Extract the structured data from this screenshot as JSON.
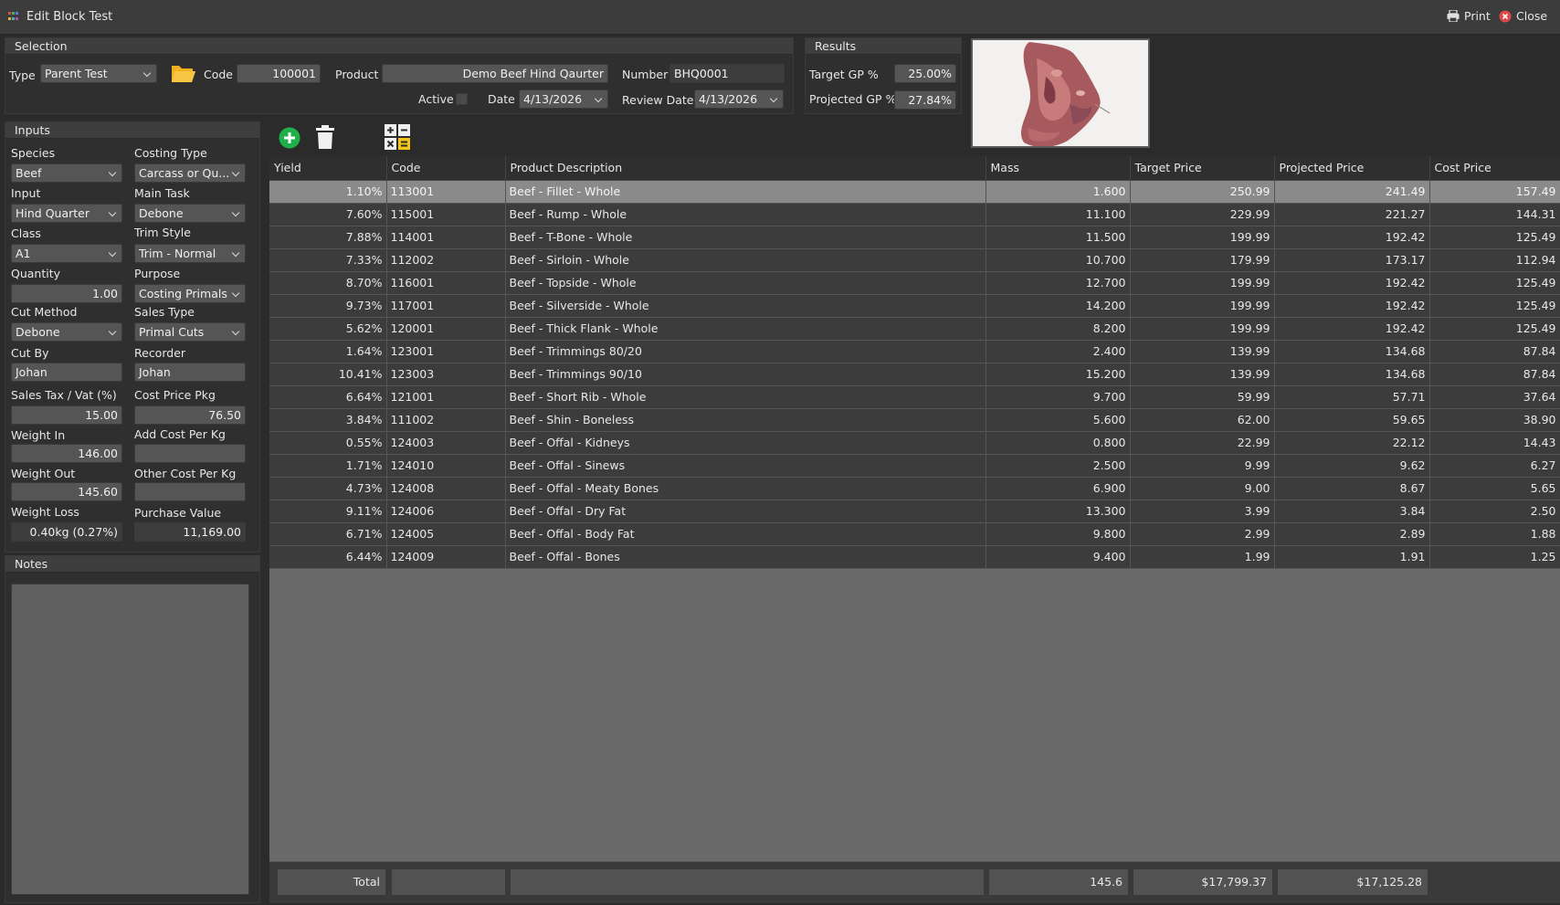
{
  "window": {
    "title": "Edit Block Test",
    "print_label": "Print",
    "close_label": "Close"
  },
  "selection": {
    "header": "Selection",
    "type_label": "Type",
    "type_value": "Parent Test",
    "code_label": "Code",
    "code_value": "100001",
    "product_label": "Product",
    "product_value": "Demo Beef Hind Qaurter",
    "number_label": "Number",
    "number_value": "BHQ0001",
    "active_label": "Active",
    "date_label": "Date",
    "date_value": "4/13/2026",
    "review_date_label": "Review Date",
    "review_date_value": "4/13/2026"
  },
  "results": {
    "header": "Results",
    "target_gp_label": "Target GP %",
    "target_gp_value": "25.00%",
    "projected_gp_label": "Projected GP %",
    "projected_gp_value": "27.84%"
  },
  "inputs": {
    "header": "Inputs",
    "species_label": "Species",
    "species_value": "Beef",
    "costing_type_label": "Costing Type",
    "costing_type_value": "Carcass or Qu...",
    "input_label": "Input",
    "input_value": "Hind Quarter",
    "main_task_label": "Main Task",
    "main_task_value": "Debone",
    "class_label": "Class",
    "class_value": "A1",
    "trim_style_label": "Trim Style",
    "trim_style_value": "Trim - Normal",
    "quantity_label": "Quantity",
    "quantity_value": "1.00",
    "purpose_label": "Purpose",
    "purpose_value": "Costing Primals",
    "cut_method_label": "Cut Method",
    "cut_method_value": "Debone",
    "sales_type_label": "Sales Type",
    "sales_type_value": "Primal Cuts",
    "cut_by_label": "Cut By",
    "cut_by_value": "Johan",
    "recorder_label": "Recorder",
    "recorder_value": "Johan",
    "sales_tax_label": "Sales Tax / Vat (%)",
    "sales_tax_value": "15.00",
    "cost_price_pkg_label": "Cost Price Pkg",
    "cost_price_pkg_value": "76.50",
    "weight_in_label": "Weight In",
    "weight_in_value": "146.00",
    "add_cost_label": "Add Cost Per Kg",
    "add_cost_value": "",
    "weight_out_label": "Weight Out",
    "weight_out_value": "145.60",
    "other_cost_label": "Other Cost Per Kg",
    "other_cost_value": "",
    "weight_loss_label": "Weight Loss",
    "weight_loss_value": "0.40kg (0.27%)",
    "purchase_value_label": "Purchase Value",
    "purchase_value_value": "11,169.00"
  },
  "notes": {
    "header": "Notes",
    "value": ""
  },
  "toolbar": {
    "add_icon": "plus-circle-icon",
    "delete_icon": "trash-icon",
    "calc_icon": "calculator-icon"
  },
  "colors": {
    "accent_green": "#1fb04a",
    "folder_yellow": "#f2b01e",
    "close_red": "#e04848",
    "calc_yellow": "#f0c419"
  },
  "grid": {
    "columns": [
      "Yield",
      "Code",
      "Product Description",
      "Mass",
      "Target Price",
      "Projected Price",
      "Cost Price"
    ],
    "rows": [
      [
        "1.10%",
        "113001",
        "Beef - Fillet - Whole",
        "1.600",
        "250.99",
        "241.49",
        "157.49"
      ],
      [
        "7.60%",
        "115001",
        "Beef - Rump - Whole",
        "11.100",
        "229.99",
        "221.27",
        "144.31"
      ],
      [
        "7.88%",
        "114001",
        "Beef - T-Bone - Whole",
        "11.500",
        "199.99",
        "192.42",
        "125.49"
      ],
      [
        "7.33%",
        "112002",
        "Beef - Sirloin - Whole",
        "10.700",
        "179.99",
        "173.17",
        "112.94"
      ],
      [
        "8.70%",
        "116001",
        "Beef - Topside - Whole",
        "12.700",
        "199.99",
        "192.42",
        "125.49"
      ],
      [
        "9.73%",
        "117001",
        "Beef - Silverside - Whole",
        "14.200",
        "199.99",
        "192.42",
        "125.49"
      ],
      [
        "5.62%",
        "120001",
        "Beef - Thick Flank - Whole",
        "8.200",
        "199.99",
        "192.42",
        "125.49"
      ],
      [
        "1.64%",
        "123001",
        "Beef - Trimmings 80/20",
        "2.400",
        "139.99",
        "134.68",
        "87.84"
      ],
      [
        "10.41%",
        "123003",
        "Beef - Trimmings 90/10",
        "15.200",
        "139.99",
        "134.68",
        "87.84"
      ],
      [
        "6.64%",
        "121001",
        "Beef - Short Rib - Whole",
        "9.700",
        "59.99",
        "57.71",
        "37.64"
      ],
      [
        "3.84%",
        "111002",
        "Beef - Shin - Boneless",
        "5.600",
        "62.00",
        "59.65",
        "38.90"
      ],
      [
        "0.55%",
        "124003",
        "Beef - Offal - Kidneys",
        "0.800",
        "22.99",
        "22.12",
        "14.43"
      ],
      [
        "1.71%",
        "124010",
        "Beef - Offal - Sinews",
        "2.500",
        "9.99",
        "9.62",
        "6.27"
      ],
      [
        "4.73%",
        "124008",
        "Beef - Offal - Meaty Bones",
        "6.900",
        "9.00",
        "8.67",
        "5.65"
      ],
      [
        "9.11%",
        "124006",
        "Beef - Offal - Dry Fat",
        "13.300",
        "3.99",
        "3.84",
        "2.50"
      ],
      [
        "6.71%",
        "124005",
        "Beef - Offal - Body Fat",
        "9.800",
        "2.99",
        "2.89",
        "1.88"
      ],
      [
        "6.44%",
        "124009",
        "Beef - Offal - Bones",
        "9.400",
        "1.99",
        "1.91",
        "1.25"
      ]
    ],
    "selected_row": 0
  },
  "totals": {
    "label": "Total",
    "mass": "145.6",
    "target_price": "$17,799.37",
    "projected_price": "$17,125.28"
  }
}
